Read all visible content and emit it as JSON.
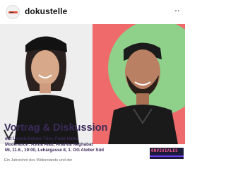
{
  "header": {
    "account": "dokustelle",
    "more": "··",
    "avatar_label": "dokustelle avatar"
  },
  "post": {
    "title": "Vortrag & Diskussion",
    "line1": "mit Ümmü-Selime Türe, Farid Hafez",
    "line2": "Moderation: Asma Aiad, Anahita Neghabat",
    "line3": "Mi, 11.6., 19:00, Lehárgasse 8, 1. OG Atelier Süd",
    "caption": "Ein Jahrzehnt des Widerstands und der",
    "badge": "ONVIVIALES"
  },
  "colors": {
    "accent_text": "#3b2a5a",
    "right_bg": "#ef6a6a",
    "right_circle": "#8fd08a",
    "badge_bg": "#1c1b3a",
    "badge_text": "#ff5c8a"
  }
}
